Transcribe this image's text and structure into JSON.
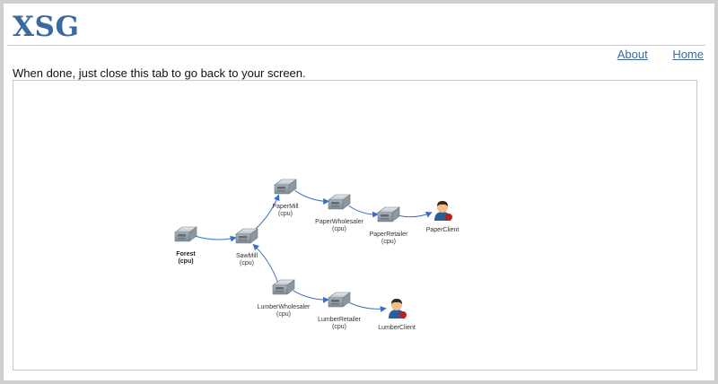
{
  "header": {
    "logo": "XSG",
    "nav": [
      {
        "label": "About"
      },
      {
        "label": "Home"
      }
    ]
  },
  "instructions": "When done, just close this tab to go back to your screen.",
  "graph": {
    "nodes": [
      {
        "id": "forest",
        "name": "Forest",
        "sub": "(cpu)",
        "kind": "server",
        "bold": true
      },
      {
        "id": "sawmill",
        "name": "SawMill",
        "sub": "(cpu)",
        "kind": "server"
      },
      {
        "id": "papermill",
        "name": "PaperMill",
        "sub": "(cpu)",
        "kind": "server"
      },
      {
        "id": "paperwholesaler",
        "name": "PaperWholesaler",
        "sub": "(cpu)",
        "kind": "server"
      },
      {
        "id": "paperretailer",
        "name": "PaperRetailer",
        "sub": "(cpu)",
        "kind": "server"
      },
      {
        "id": "paperclient",
        "name": "PaperClient",
        "sub": "",
        "kind": "user"
      },
      {
        "id": "lumberwholesaler",
        "name": "LumberWholesaler",
        "sub": "(cpu)",
        "kind": "server"
      },
      {
        "id": "lumberretailer",
        "name": "LumberRetailer",
        "sub": "(cpu)",
        "kind": "server"
      },
      {
        "id": "lumberclient",
        "name": "LumberClient",
        "sub": "",
        "kind": "user"
      }
    ],
    "edges": [
      [
        "forest",
        "sawmill"
      ],
      [
        "sawmill",
        "papermill"
      ],
      [
        "papermill",
        "paperwholesaler"
      ],
      [
        "paperwholesaler",
        "paperretailer"
      ],
      [
        "paperretailer",
        "paperclient"
      ],
      [
        "lumberwholesaler",
        "sawmill"
      ],
      [
        "lumberwholesaler",
        "lumberretailer"
      ],
      [
        "lumberretailer",
        "lumberclient"
      ]
    ],
    "colors": {
      "edge": "#3a6fc4",
      "server": "#9aa5ad",
      "user_body": "#2a5d9a",
      "user_face": "#f0c08a",
      "user_hair": "#3a2416",
      "user_badge": "#c0201a"
    }
  }
}
